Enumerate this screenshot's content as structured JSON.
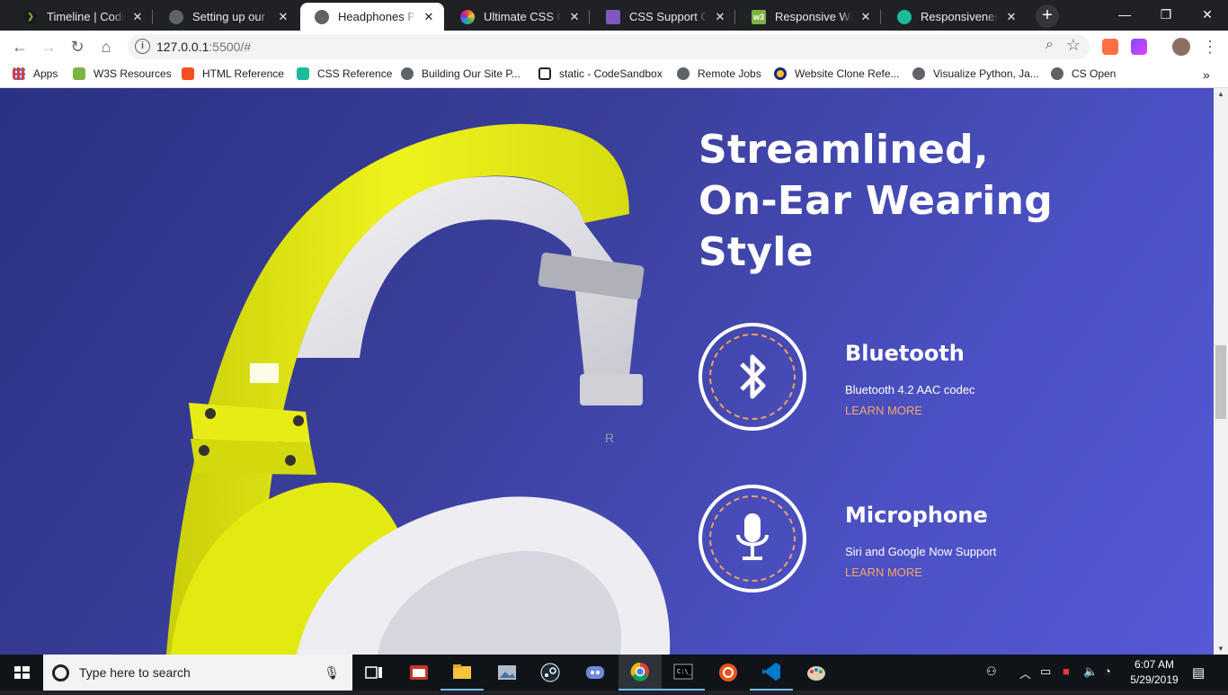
{
  "browser": {
    "tabs": [
      {
        "title": "Timeline | CodingPhase",
        "favicon_color": "#1b1b1b",
        "active": false
      },
      {
        "title": "Setting up our menu",
        "favicon_color": "#5f6368",
        "active": false
      },
      {
        "title": "Headphones Power",
        "favicon_color": "#5f6368",
        "active": true
      },
      {
        "title": "Ultimate CSS Gradient",
        "favicon_color": "#e8453c",
        "active": false
      },
      {
        "title": "CSS Support Guide",
        "favicon_color": "#7e57c2",
        "active": false
      },
      {
        "title": "Responsive Web Design",
        "favicon_color": "#7cb342",
        "active": false
      },
      {
        "title": "Responsiveness | B",
        "favicon_color": "#1abc9c",
        "active": false
      }
    ],
    "close_glyph": "✕",
    "new_tab_glyph": "+",
    "window_controls": {
      "minimize": "—",
      "maximize": "❐",
      "close": "✕"
    },
    "address": {
      "host": "127.0.0.1",
      "rest": ":5500/#"
    },
    "bookmarks": [
      {
        "label": "Apps",
        "color": "#e53935"
      },
      {
        "label": "W3S Resources",
        "color": "#7cb342"
      },
      {
        "label": "HTML Reference",
        "color": "#f4511e"
      },
      {
        "label": "CSS Reference",
        "color": "#1abc9c"
      },
      {
        "label": "Building Our Site P...",
        "color": "#5f6368"
      },
      {
        "label": "static - CodeSandbox",
        "color": "#202124"
      },
      {
        "label": "Remote Jobs",
        "color": "#5f6368"
      },
      {
        "label": "Website Clone Refe...",
        "color": "#1a237e"
      },
      {
        "label": "Visualize Python, Ja...",
        "color": "#5f6368"
      },
      {
        "label": "CS Open",
        "color": "#5f6368"
      }
    ],
    "more_bookmarks": "»"
  },
  "page": {
    "headline": [
      "Streamlined,",
      "On-Ear Wearing",
      "Style"
    ],
    "colors": {
      "background_start": "#2a3283",
      "background_end": "#5658d6",
      "accent": "#f4a66a",
      "headphone_yellow": "#e3ea12"
    },
    "features": [
      {
        "title": "Bluetooth",
        "description": "Bluetooth 4.2 AAC codec",
        "link": "LEARN MORE",
        "icon": "bluetooth-icon"
      },
      {
        "title": "Microphone",
        "description": "Siri and Google Now Support",
        "link": "LEARN MORE",
        "icon": "microphone-icon"
      }
    ],
    "headphone_marks": {
      "cup_letter": "R"
    }
  },
  "taskbar": {
    "search_placeholder": "Type here to search",
    "time": "6:07 AM",
    "date": "5/29/2019",
    "apps": [
      "task-view-icon",
      "screenshot-app-icon",
      "file-explorer-icon",
      "photos-icon",
      "steam-icon",
      "discord-icon",
      "chrome-icon",
      "terminal-icon",
      "ubuntu-icon",
      "vscode-icon",
      "paint-icon"
    ]
  }
}
